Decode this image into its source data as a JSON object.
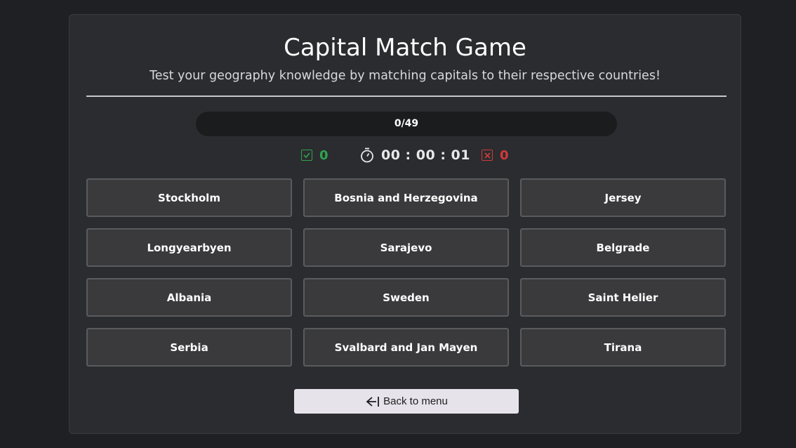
{
  "header": {
    "title": "Capital Match Game",
    "subtitle": "Test your geography knowledge by matching capitals to their respective countries!"
  },
  "progress": {
    "label": "0/49",
    "current": 0,
    "total": 49,
    "fraction": 0
  },
  "stats": {
    "correct": "0",
    "timer": "00 : 00 : 01",
    "wrong": "0",
    "correct_icon": "check-square-icon",
    "timer_icon": "stopwatch-icon",
    "wrong_icon": "x-square-icon"
  },
  "tiles": [
    "Stockholm",
    "Bosnia and Herzegovina",
    "Jersey",
    "Longyearbyen",
    "Sarajevo",
    "Belgrade",
    "Albania",
    "Sweden",
    "Saint Helier",
    "Serbia",
    "Svalbard and Jan Mayen",
    "Tirana"
  ],
  "footer": {
    "back_label": "Back to menu",
    "back_icon": "arrow-left-bar-icon"
  },
  "colors": {
    "correct": "#2fa44f",
    "wrong": "#d23a3a",
    "tile_bg": "#3a3a3c",
    "card_bg": "#2b2c2f",
    "page_bg": "#1f2023"
  }
}
